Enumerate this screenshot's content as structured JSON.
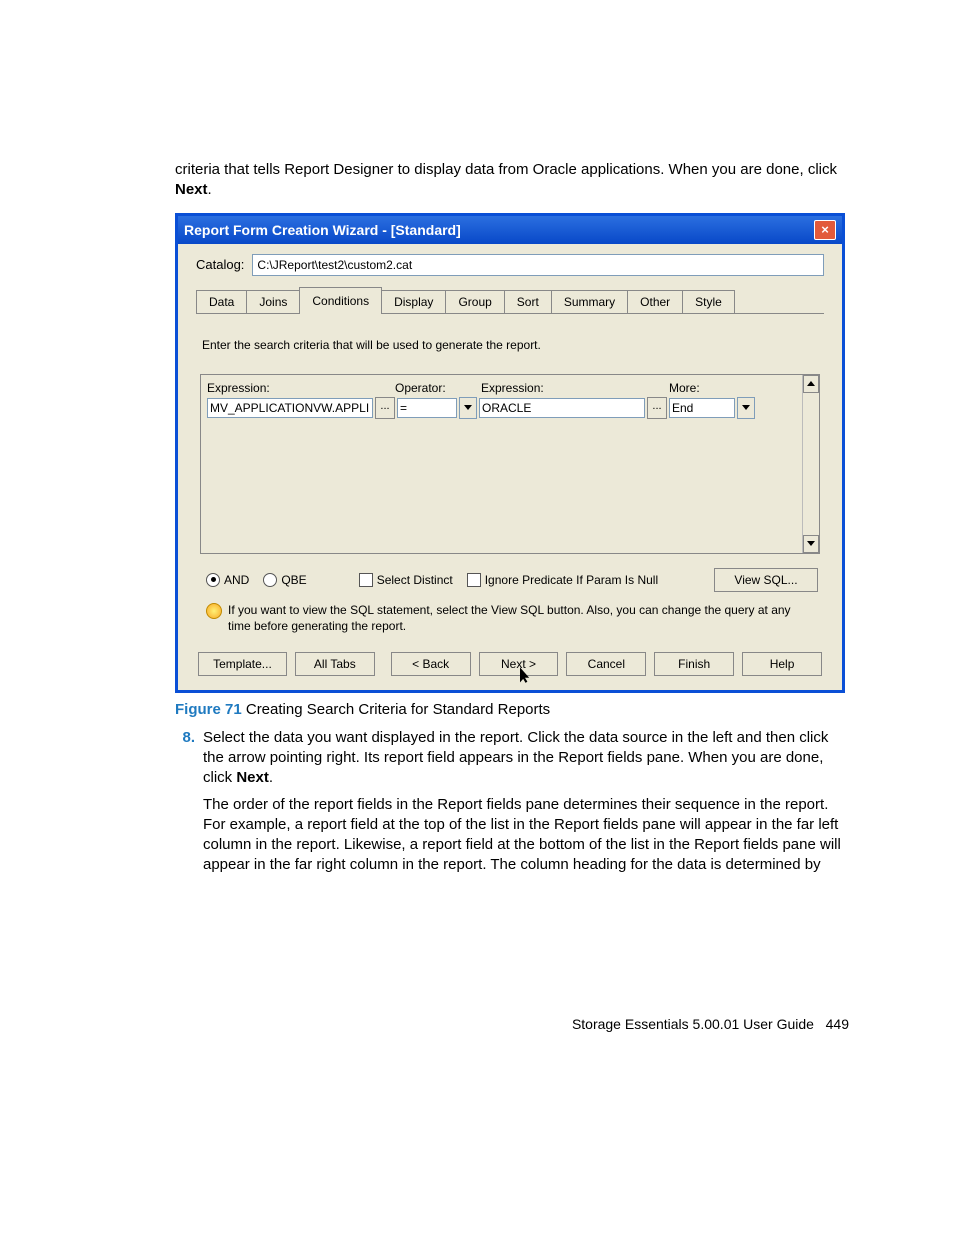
{
  "intro": "criteria that tells Report Designer to display data from Oracle applications. When you are done, click ",
  "intro_bold": "Next",
  "intro_tail": ".",
  "window": {
    "title": "Report Form Creation Wizard - [Standard]",
    "catalog_label": "Catalog:",
    "catalog_value": "C:\\JReport\\test2\\custom2.cat",
    "tabs": [
      "Data",
      "Joins",
      "Conditions",
      "Display",
      "Group",
      "Sort",
      "Summary",
      "Other",
      "Style"
    ],
    "active_tab_index": 2,
    "instruction": "Enter the search criteria that will be used to generate the report.",
    "col_headers": {
      "expr1": "Expression:",
      "op": "Operator:",
      "expr2": "Expression:",
      "more": "More:"
    },
    "row": {
      "expr1": "MV_APPLICATIONVW.APPLI",
      "op": "=",
      "expr2": "ORACLE",
      "more": "End"
    },
    "options": {
      "and": "AND",
      "qbe": "QBE",
      "distinct": "Select Distinct",
      "ignore": "Ignore Predicate If Param Is Null",
      "viewsql": "View SQL..."
    },
    "hint": "If you want to view the SQL statement, select the View SQL button.  Also, you can change the query at any time before generating the report.",
    "buttons": {
      "template": "Template...",
      "alltabs": "All Tabs",
      "back": "< Back",
      "next": "Next >",
      "cancel": "Cancel",
      "finish": "Finish",
      "help": "Help"
    }
  },
  "figure": {
    "label": "Figure 71",
    "caption": " Creating Search Criteria for Standard Reports"
  },
  "step8_num": "8.",
  "step8_a": "Select the data you want displayed in the report. Click the data source in the left and then click the arrow pointing right. Its report field appears in the Report fields pane. When you are done, click ",
  "step8_bold": "Next",
  "step8_tail": ".",
  "step8_para": "The order of the report fields in the Report fields pane determines their sequence in the report. For example, a report field at the top of the list in the Report fields pane will appear in the far left column in the report. Likewise, a report field at the bottom of the list in the Report fields pane will appear in the far right column in the report. The column heading for the data is determined by",
  "footer_text": "Storage Essentials 5.00.01 User Guide",
  "footer_page": "449"
}
